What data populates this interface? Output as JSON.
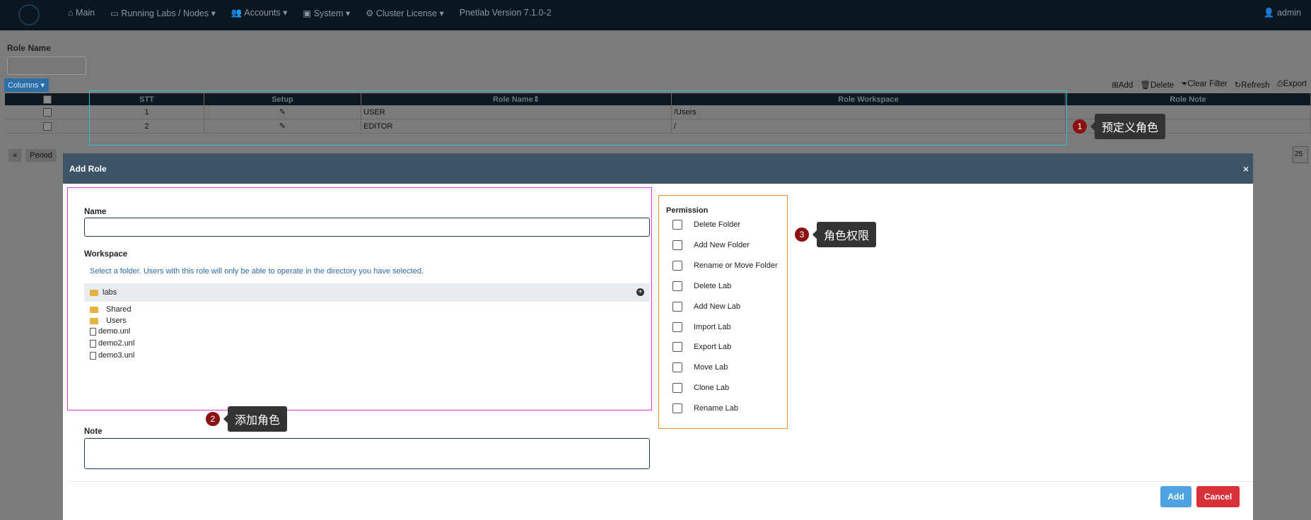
{
  "navbar": {
    "items": [
      "Main",
      "Running Labs / Nodes",
      "Accounts",
      "System",
      "Cluster License",
      "Pnetlab Version 7.1.0-2"
    ],
    "user": "admin"
  },
  "filter": {
    "role_name_label": "Role Name"
  },
  "grid": {
    "columns_button": "Columns",
    "toolbar": [
      "Add",
      "Delete",
      "Clear Filter",
      "Refresh",
      "Export"
    ],
    "headers": {
      "stt": "STT",
      "setup": "Setup",
      "role_name": "Role Name",
      "role_workspace": "Role Workspace",
      "role_note": "Role Note"
    },
    "rows": [
      {
        "stt": "1",
        "role_name": "USER",
        "role_workspace": "/Users",
        "role_note": ""
      },
      {
        "stt": "2",
        "role_name": "EDITOR",
        "role_workspace": "/",
        "role_note": ""
      }
    ],
    "pager": {
      "first": "«",
      "period": "Period"
    },
    "per_page": "25"
  },
  "annotations": {
    "n1": "1",
    "t1": "预定义角色",
    "n2": "2",
    "t2": "添加角色",
    "n3": "3",
    "t3": "角色权限"
  },
  "modal": {
    "title": "Add Role",
    "close": "×",
    "name_label": "Name",
    "workspace_label": "Workspace",
    "workspace_help": "Select a folder. Users with this role will only be able to operate in the directory you have selected.",
    "tree": {
      "root": "labs",
      "folders": [
        "Shared",
        "Users"
      ],
      "files": [
        "demo.unl",
        "demo2.unl",
        "demo3.unl"
      ]
    },
    "permission_title": "Permission",
    "permissions": [
      "Delete Folder",
      "Add New Folder",
      "Rename or Move Folder",
      "Delete Lab",
      "Add New Lab",
      "Import Lab",
      "Export Lab",
      "Move Lab",
      "Clone Lab",
      "Rename Lab"
    ],
    "note_label": "Note",
    "add_button": "Add",
    "cancel_button": "Cancel"
  }
}
